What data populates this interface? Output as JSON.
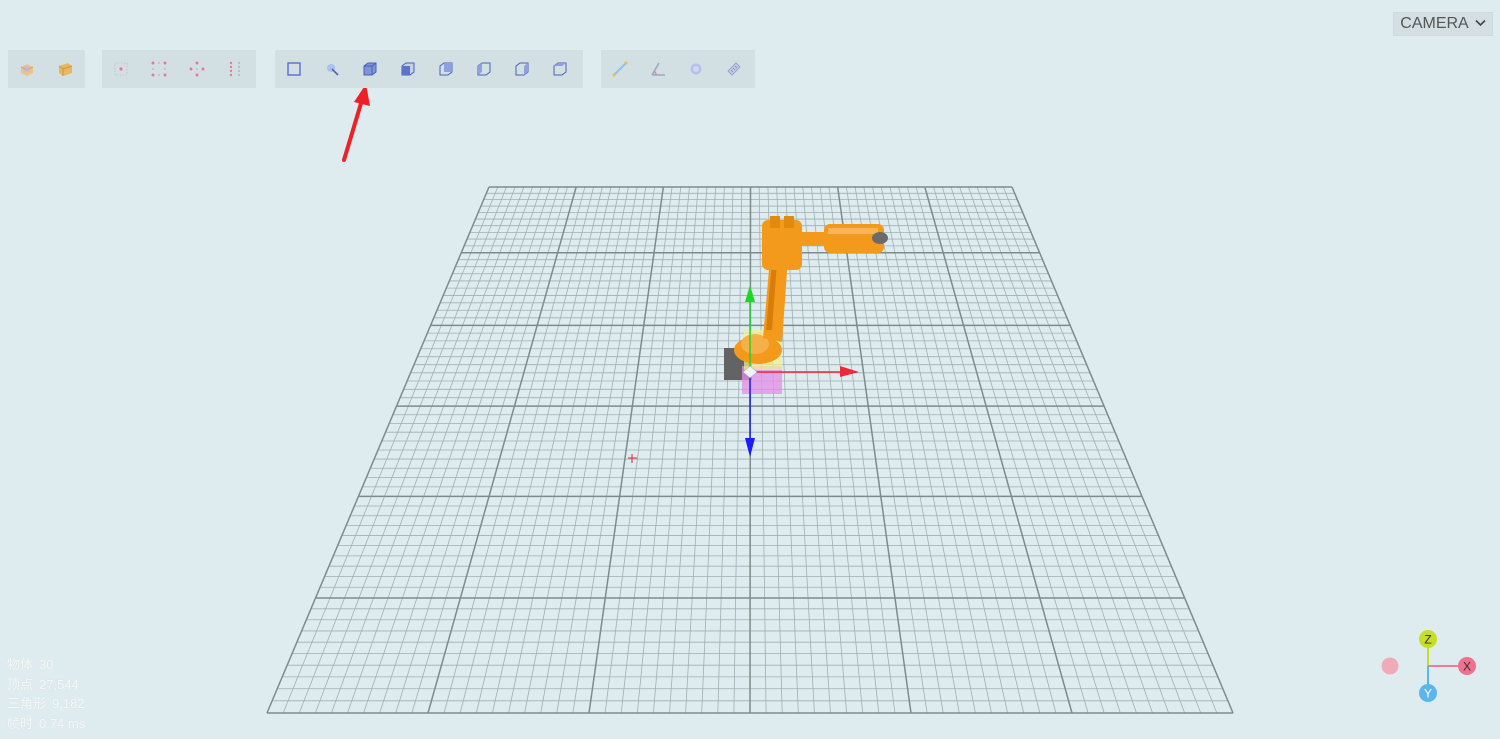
{
  "camera_menu": {
    "label": "CAMERA",
    "chevron": "chevron-down-icon"
  },
  "toolbar": {
    "groups": [
      {
        "name": "object-group",
        "buttons": [
          {
            "icon": "object-icon"
          },
          {
            "icon": "object-surface-icon"
          }
        ]
      },
      {
        "name": "point-snap-group",
        "buttons": [
          {
            "icon": "center-point-icon"
          },
          {
            "icon": "corner-points-icon"
          },
          {
            "icon": "midpoint-icon"
          },
          {
            "icon": "grid-points-icon"
          }
        ]
      },
      {
        "name": "view-group",
        "buttons": [
          {
            "icon": "frame-select-icon"
          },
          {
            "icon": "select-cursor-icon"
          },
          {
            "icon": "cube-iso-icon"
          },
          {
            "icon": "cube-front-icon"
          },
          {
            "icon": "cube-back-icon"
          },
          {
            "icon": "cube-left-icon"
          },
          {
            "icon": "cube-right-icon"
          },
          {
            "icon": "cube-top-icon"
          }
        ]
      },
      {
        "name": "measure-group",
        "buttons": [
          {
            "icon": "measure-distance-icon"
          },
          {
            "icon": "measure-angle-icon"
          },
          {
            "icon": "measure-circle-icon"
          },
          {
            "icon": "measure-ruler-icon"
          }
        ]
      }
    ]
  },
  "stats": {
    "objects_label": "物体",
    "objects_value": "30",
    "vertices_label": "顶点",
    "vertices_value": "27,544",
    "triangles_label": "三角形",
    "triangles_value": "9,182",
    "frame_label": "帧时",
    "frame_value": "0.74 ms"
  },
  "axis_gizmo": {
    "z": "Z",
    "x": "X",
    "y": "Y"
  },
  "colors": {
    "background": "#deecef",
    "grid": "#7d8b8b",
    "robot": "#f39a1c",
    "axis_x": "#f0263a",
    "axis_y": "#1b1df5",
    "axis_z": "#1fd52a",
    "annotation_arrow": "#ee1f26"
  }
}
